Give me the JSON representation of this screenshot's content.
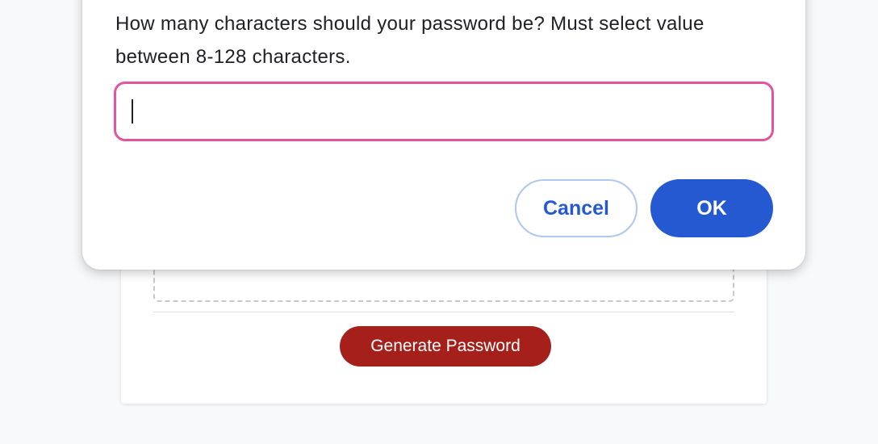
{
  "app": {
    "generate_button_label": "Generate Password",
    "password_output": ""
  },
  "dialog": {
    "message": "How many characters should your password be? Must select value between 8-128 characters.",
    "input_value": "",
    "cancel_label": "Cancel",
    "ok_label": "OK"
  },
  "colors": {
    "page_background": "#f8f9fb",
    "generate_button": "#a5201a",
    "ok_button": "#2459d1",
    "cancel_border": "#aec7ee",
    "input_focus_border": "#e0559e"
  }
}
